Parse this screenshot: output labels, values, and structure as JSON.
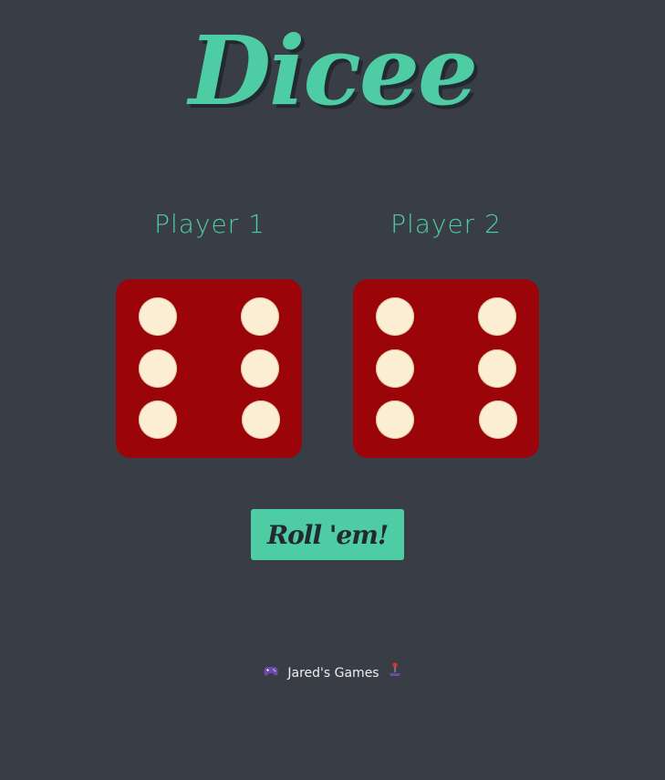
{
  "app": {
    "title": "Dicee"
  },
  "players": [
    {
      "label": "Player 1",
      "die_value": 6
    },
    {
      "label": "Player 2",
      "die_value": 6
    }
  ],
  "actions": {
    "roll_label": "Roll 'em!"
  },
  "footer": {
    "left_icon": "game-controller-icon",
    "text": "Jared's Games",
    "right_icon": "joystick-icon"
  },
  "colors": {
    "background": "#393e46",
    "accent": "#4ecca3",
    "die": "#9b050a",
    "pip": "#fbeed3",
    "shadow": "#232931"
  }
}
